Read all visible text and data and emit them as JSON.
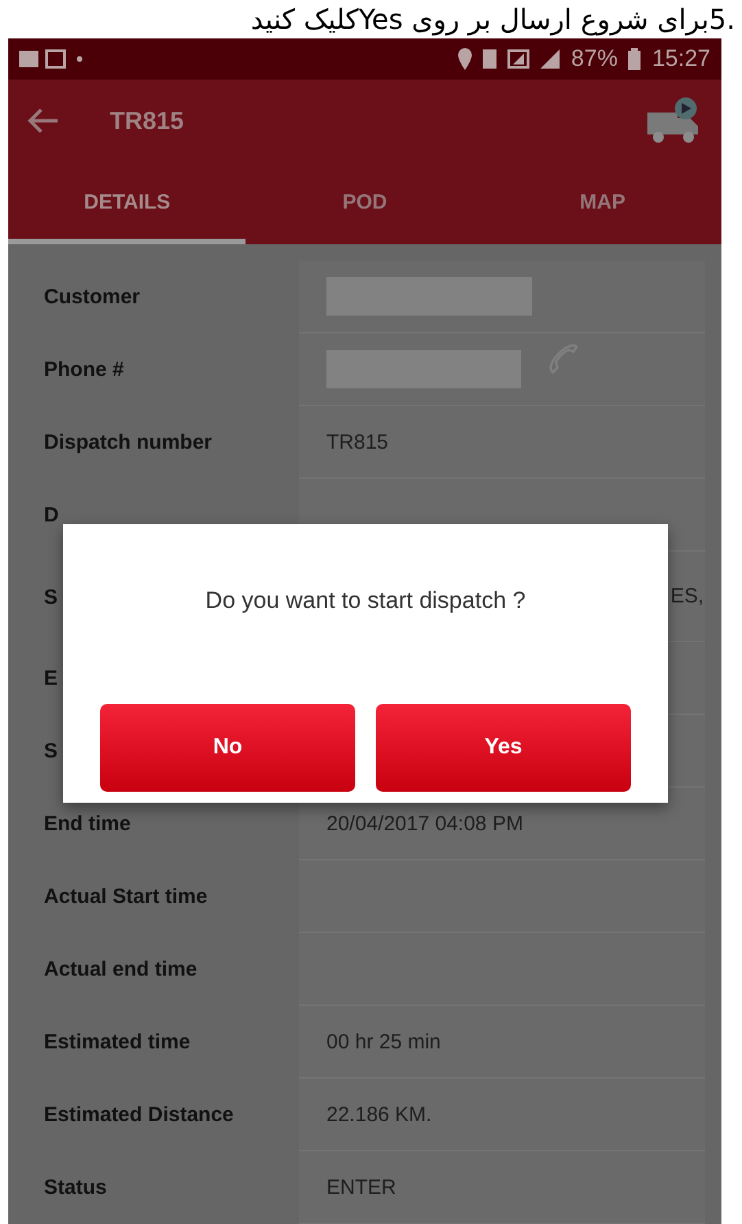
{
  "caption": ".5برای شروع ارسال بر روی  Yesکلیک کنید",
  "status_bar": {
    "battery": "87%",
    "time": "15:27"
  },
  "toolbar": {
    "title": "TR815"
  },
  "tabs": [
    {
      "label": "DETAILS",
      "selected": true
    },
    {
      "label": "POD",
      "selected": false
    },
    {
      "label": "MAP",
      "selected": false
    }
  ],
  "rows": [
    {
      "kind": "redacted",
      "label": "Customer"
    },
    {
      "kind": "phone",
      "label": "Phone #"
    },
    {
      "kind": "text",
      "label": "Dispatch number",
      "value": "TR815"
    },
    {
      "kind": "covered",
      "label": "D"
    },
    {
      "kind": "covered",
      "label": "S",
      "value": "ES,"
    },
    {
      "kind": "covered",
      "label": "E"
    },
    {
      "kind": "covered",
      "label": "S"
    },
    {
      "kind": "text",
      "label": "End time",
      "value": "20/04/2017 04:08 PM"
    },
    {
      "kind": "text",
      "label": "Actual Start time"
    },
    {
      "kind": "text",
      "label": "Actual end time"
    },
    {
      "kind": "text",
      "label": "Estimated time",
      "value": "00 hr 25 min"
    },
    {
      "kind": "text",
      "label": "Estimated Distance",
      "value": "22.186 KM."
    },
    {
      "kind": "text",
      "label": "Status",
      "value": "ENTER"
    }
  ],
  "dialog": {
    "message": "Do you want to start dispatch ?",
    "buttons": [
      "No",
      "Yes"
    ]
  }
}
